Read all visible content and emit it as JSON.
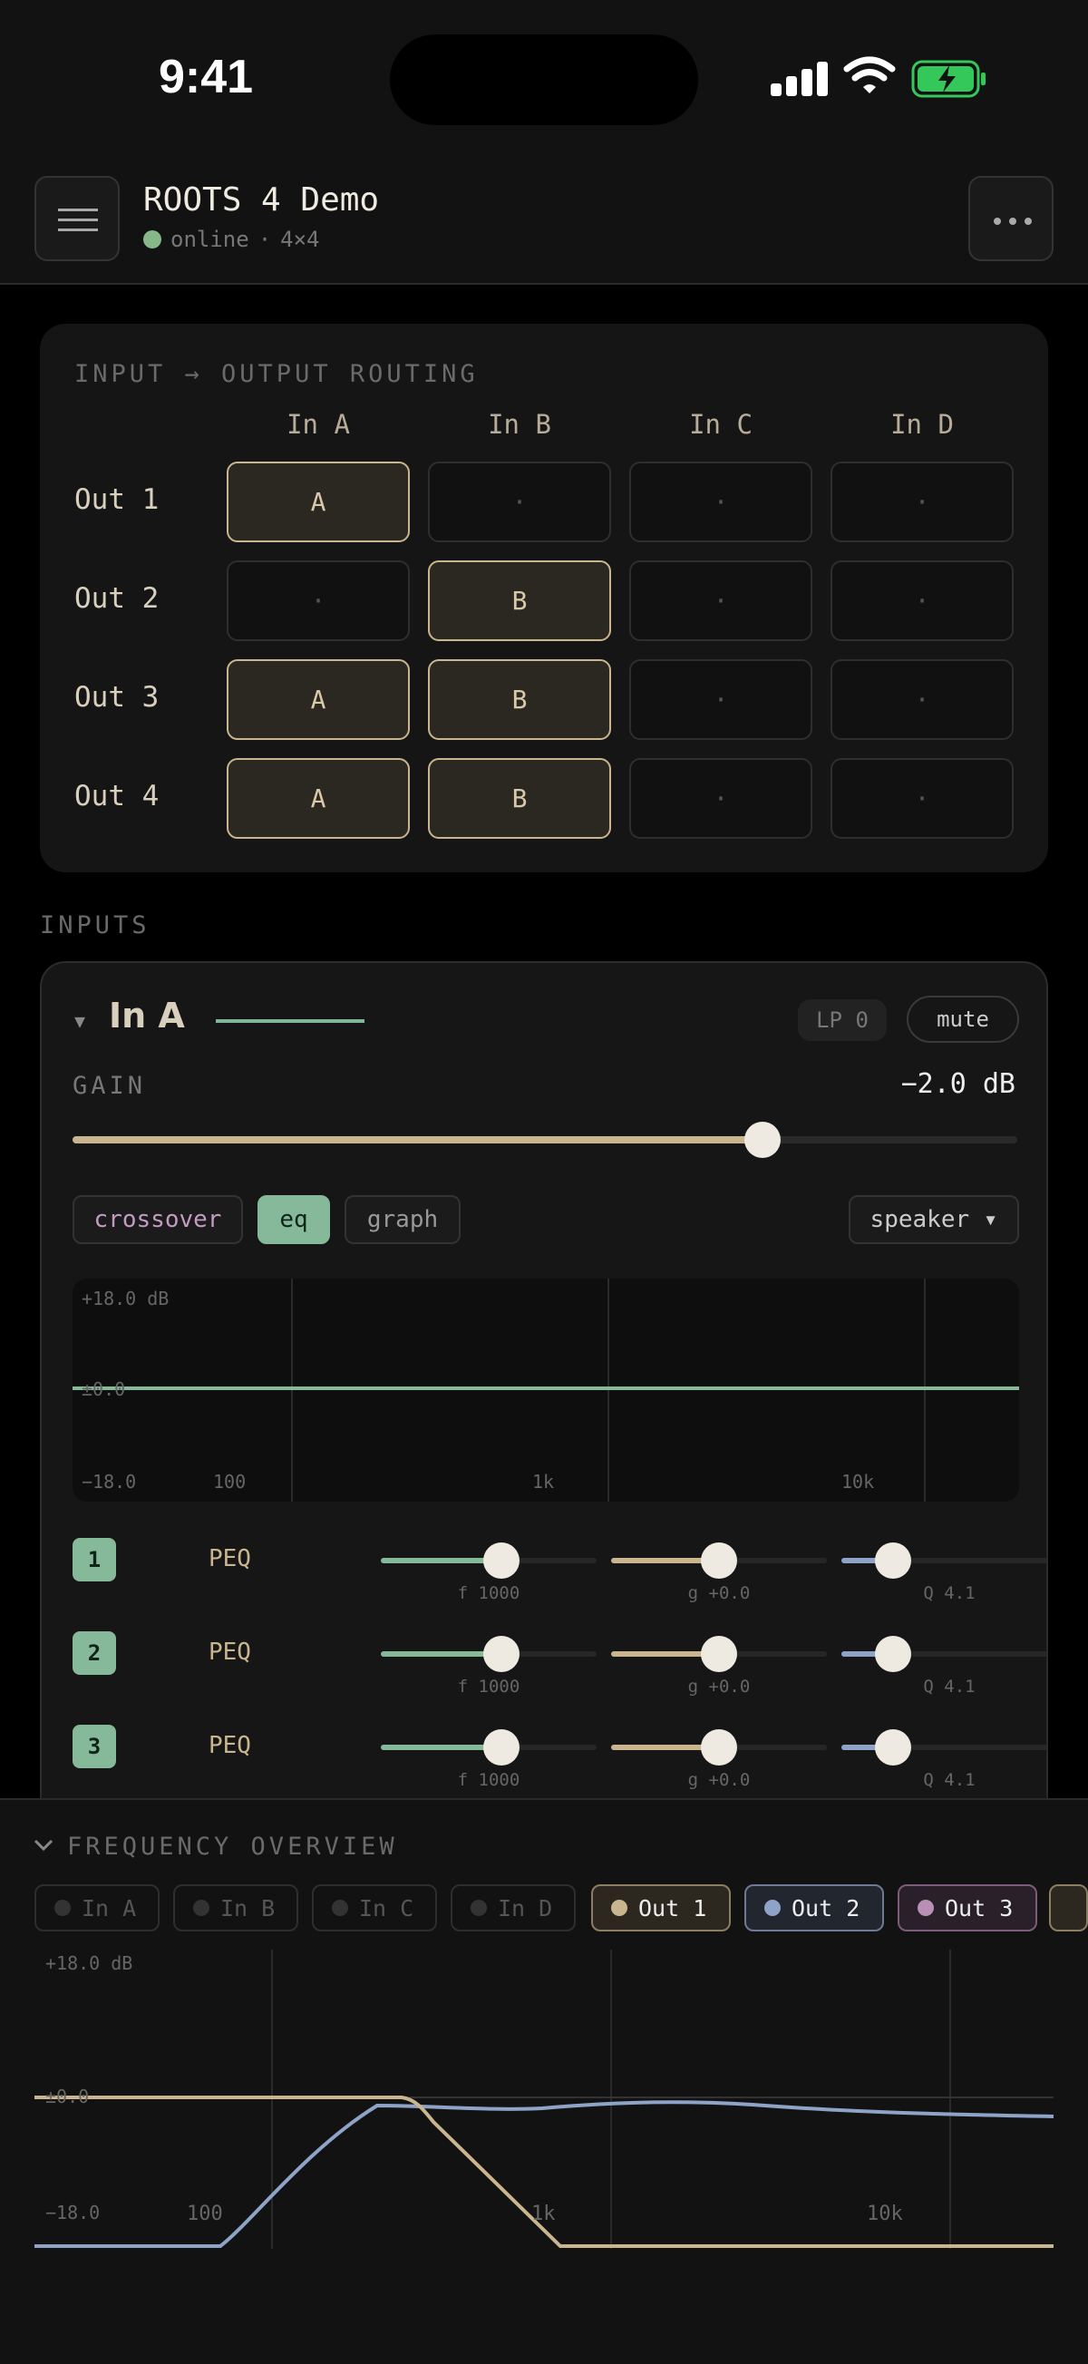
{
  "status_bar": {
    "time": "9:41",
    "battery_color": "#34c759"
  },
  "header": {
    "title": "ROOTS 4 Demo",
    "status": "online",
    "separator": "·",
    "matrix": "4×4",
    "menu_icon": "hamburger-icon",
    "more_icon": "more-horizontal-icon"
  },
  "routing": {
    "label": "INPUT → OUTPUT ROUTING",
    "columns": [
      "In A",
      "In B",
      "In C",
      "In D"
    ],
    "rows": [
      {
        "label": "Out 1",
        "cells": [
          "A",
          "·",
          "·",
          "·"
        ],
        "active": [
          true,
          false,
          false,
          false
        ]
      },
      {
        "label": "Out 2",
        "cells": [
          "·",
          "B",
          "·",
          "·"
        ],
        "active": [
          false,
          true,
          false,
          false
        ]
      },
      {
        "label": "Out 3",
        "cells": [
          "A",
          "B",
          "·",
          "·"
        ],
        "active": [
          true,
          true,
          false,
          false
        ]
      },
      {
        "label": "Out 4",
        "cells": [
          "A",
          "B",
          "·",
          "·"
        ],
        "active": [
          true,
          true,
          false,
          false
        ]
      }
    ]
  },
  "inputs": {
    "label": "INPUTS",
    "card": {
      "name": "In A",
      "accent": "#7fb79a",
      "lp_chip": "LP 0",
      "mute_label": "mute",
      "gain_label": "GAIN",
      "gain_value": "−2.0 dB",
      "gain_fraction": 0.73,
      "tabs": {
        "crossover": "crossover",
        "eq": "eq",
        "graph": "graph"
      },
      "speaker_select": "speaker ▾",
      "graph": {
        "top": "+18.0 dB",
        "mid": "±0.0",
        "bottom": "−18.0",
        "x_ticks": [
          "100",
          "1k",
          "10k"
        ]
      },
      "bands": [
        {
          "num": "1",
          "type": "PEQ",
          "f": "f 1000",
          "g": "g +0.0",
          "q": "Q 4.1",
          "f_frac": 0.56,
          "g_frac": 0.5,
          "q_frac": 0.24
        },
        {
          "num": "2",
          "type": "PEQ",
          "f": "f 1000",
          "g": "g +0.0",
          "q": "Q 4.1",
          "f_frac": 0.56,
          "g_frac": 0.5,
          "q_frac": 0.24
        },
        {
          "num": "3",
          "type": "PEQ",
          "f": "f 1000",
          "g": "g +0.0",
          "q": "Q 4.1",
          "f_frac": 0.56,
          "g_frac": 0.5,
          "q_frac": 0.24
        }
      ]
    }
  },
  "overview": {
    "title": "FREQUENCY OVERVIEW",
    "pills": [
      {
        "label": "In A",
        "color": "#333333",
        "active": false
      },
      {
        "label": "In B",
        "color": "#333333",
        "active": false
      },
      {
        "label": "In C",
        "color": "#333333",
        "active": false
      },
      {
        "label": "In D",
        "color": "#333333",
        "active": false
      },
      {
        "label": "Out 1",
        "color": "#c9b68f",
        "active": true
      },
      {
        "label": "Out 2",
        "color": "#8fa3c8",
        "active": true
      },
      {
        "label": "Out 3",
        "color": "#b98fb6",
        "active": true
      }
    ],
    "graph": {
      "top": "+18.0 dB",
      "mid": "±0.0",
      "bottom": "−18.0",
      "x_ticks": [
        "100",
        "1k",
        "10k"
      ]
    }
  },
  "colors": {
    "gold": "#c9b68f",
    "green": "#86b89a",
    "blue": "#8fa3c8",
    "purple": "#b98fb6"
  }
}
